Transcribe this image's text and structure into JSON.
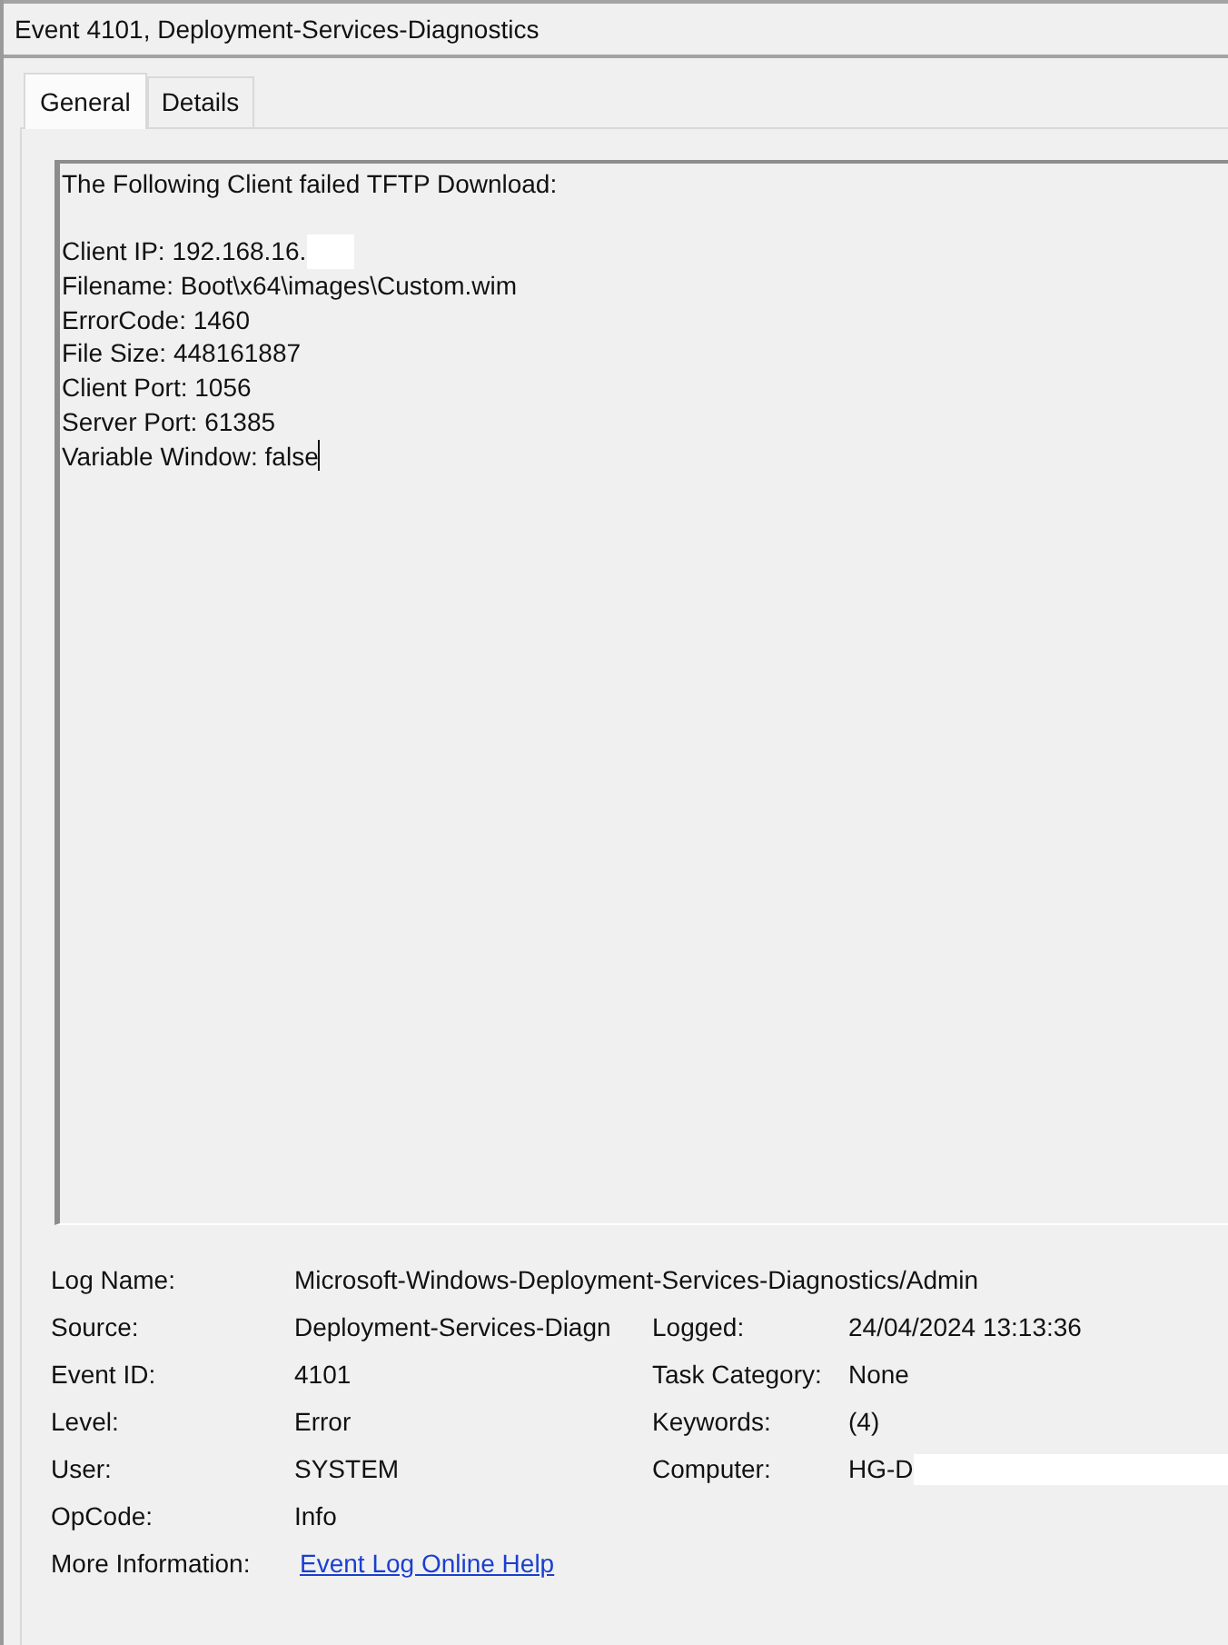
{
  "window": {
    "title": "Event 4101, Deployment-Services-Diagnostics"
  },
  "tabs": [
    {
      "label": "General",
      "selected": true
    },
    {
      "label": "Details",
      "selected": false
    }
  ],
  "description": {
    "heading": "The Following Client failed TFTP Download:",
    "lines": [
      {
        "text": "Client IP: 192.168.16.",
        "redacted": true
      },
      {
        "text": "Filename: Boot\\x64\\images\\Custom.wim",
        "redacted": false
      },
      {
        "text": "ErrorCode: 1460",
        "redacted": false
      },
      {
        "text": "File Size: 448161887",
        "redacted": false
      },
      {
        "text": "Client Port: 1056",
        "redacted": false
      },
      {
        "text": "Server Port: 61385",
        "redacted": false
      },
      {
        "text": "Variable Window: false",
        "redacted": false
      }
    ],
    "cursor": true
  },
  "properties": [
    {
      "left": {
        "label": "Log Name:",
        "value": "Microsoft-Windows-Deployment-Services-Diagnostics/Admin",
        "kind": "text",
        "redacted": false
      }
    },
    {
      "left": {
        "label": "Source:",
        "value": "Deployment-Services-Diagn",
        "kind": "text",
        "redacted": false
      },
      "right": {
        "label": "Logged:",
        "value": "24/04/2024 13:13:36",
        "kind": "text",
        "redacted": false
      }
    },
    {
      "left": {
        "label": "Event ID:",
        "value": "4101",
        "kind": "text",
        "redacted": false
      },
      "right": {
        "label": "Task Category:",
        "value": "None",
        "kind": "text",
        "redacted": false
      }
    },
    {
      "left": {
        "label": "Level:",
        "value": "Error",
        "kind": "text",
        "redacted": false
      },
      "right": {
        "label": "Keywords:",
        "value": "(4)",
        "kind": "text",
        "redacted": false
      }
    },
    {
      "left": {
        "label": "User:",
        "value": "SYSTEM",
        "kind": "text",
        "redacted": false
      },
      "right": {
        "label": "Computer:",
        "value": "HG-D",
        "kind": "text",
        "redacted": true
      }
    },
    {
      "left": {
        "label": "OpCode:",
        "value": "Info",
        "kind": "text",
        "redacted": false
      }
    },
    {
      "left": {
        "label": "More Information:",
        "value": "Event Log Online Help",
        "kind": "link",
        "redacted": false
      }
    }
  ]
}
